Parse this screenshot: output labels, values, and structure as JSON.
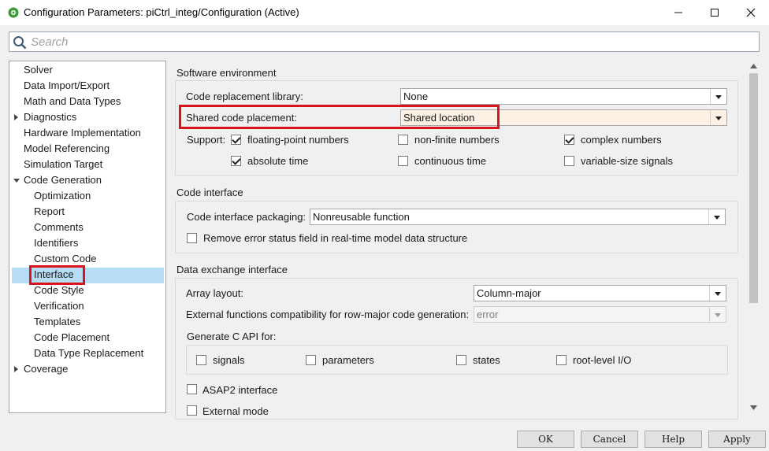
{
  "window": {
    "title": "Configuration Parameters: piCtrl_integ/Configuration (Active)",
    "icons": {
      "app": "matlab-config-icon",
      "minimize": "minimize-icon",
      "maximize": "maximize-icon",
      "close": "close-icon"
    }
  },
  "search": {
    "placeholder": "Search",
    "icon": "search-icon"
  },
  "tree": {
    "items": [
      {
        "label": "Solver",
        "level": 0,
        "expander": "none"
      },
      {
        "label": "Data Import/Export",
        "level": 0,
        "expander": "none"
      },
      {
        "label": "Math and Data Types",
        "level": 0,
        "expander": "none"
      },
      {
        "label": "Diagnostics",
        "level": 0,
        "expander": "collapsed"
      },
      {
        "label": "Hardware Implementation",
        "level": 0,
        "expander": "none"
      },
      {
        "label": "Model Referencing",
        "level": 0,
        "expander": "none"
      },
      {
        "label": "Simulation Target",
        "level": 0,
        "expander": "none"
      },
      {
        "label": "Code Generation",
        "level": 0,
        "expander": "expanded"
      },
      {
        "label": "Optimization",
        "level": 1,
        "expander": "none"
      },
      {
        "label": "Report",
        "level": 1,
        "expander": "none"
      },
      {
        "label": "Comments",
        "level": 1,
        "expander": "none"
      },
      {
        "label": "Identifiers",
        "level": 1,
        "expander": "none"
      },
      {
        "label": "Custom Code",
        "level": 1,
        "expander": "none"
      },
      {
        "label": "Interface",
        "level": 1,
        "expander": "none",
        "selected": true
      },
      {
        "label": "Code Style",
        "level": 1,
        "expander": "none"
      },
      {
        "label": "Verification",
        "level": 1,
        "expander": "none"
      },
      {
        "label": "Templates",
        "level": 1,
        "expander": "none"
      },
      {
        "label": "Code Placement",
        "level": 1,
        "expander": "none"
      },
      {
        "label": "Data Type Replacement",
        "level": 1,
        "expander": "none"
      },
      {
        "label": "Coverage",
        "level": 0,
        "expander": "collapsed"
      }
    ]
  },
  "software_env": {
    "title": "Software environment",
    "code_replacement_label": "Code replacement library:",
    "code_replacement_value": "None",
    "shared_code_label": "Shared code placement:",
    "shared_code_value": "Shared location",
    "support_label": "Support:",
    "support": [
      {
        "label": "floating-point numbers",
        "checked": true
      },
      {
        "label": "non-finite numbers",
        "checked": false
      },
      {
        "label": "complex numbers",
        "checked": true
      },
      {
        "label": "absolute time",
        "checked": true
      },
      {
        "label": "continuous time",
        "checked": false
      },
      {
        "label": "variable-size signals",
        "checked": false
      }
    ]
  },
  "code_interface": {
    "title": "Code interface",
    "packaging_label": "Code interface packaging:",
    "packaging_value": "Nonreusable function",
    "remove_error_label": "Remove error status field in real-time model data structure",
    "remove_error_checked": false
  },
  "data_exchange": {
    "title": "Data exchange interface",
    "array_layout_label": "Array layout:",
    "array_layout_value": "Column-major",
    "ext_funcs_label": "External functions compatibility for row-major code generation:",
    "ext_funcs_value": "error",
    "c_api_label": "Generate C API for:",
    "c_api": [
      {
        "label": "signals",
        "checked": false
      },
      {
        "label": "parameters",
        "checked": false
      },
      {
        "label": "states",
        "checked": false
      },
      {
        "label": "root-level I/O",
        "checked": false
      }
    ],
    "asap2_label": "ASAP2 interface",
    "external_mode_label": "External mode"
  },
  "buttons": {
    "ok": "OK",
    "cancel": "Cancel",
    "help": "Help",
    "apply": "Apply"
  },
  "colors": {
    "selection": "#b7dcf5",
    "highlight_box": "#d9141c",
    "dropdown_active": "#fdf0e4"
  }
}
